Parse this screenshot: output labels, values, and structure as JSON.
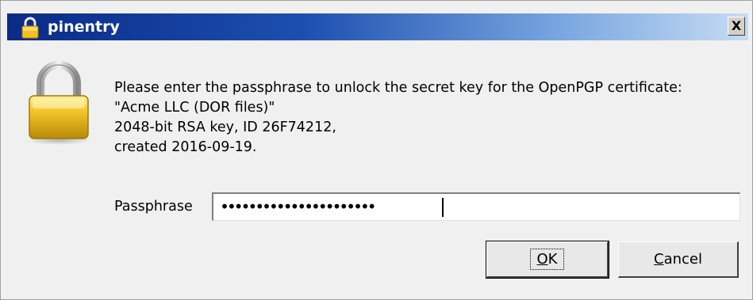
{
  "window": {
    "title": "pinentry",
    "close_label": "X",
    "title_icon": "lock-icon"
  },
  "dialog": {
    "icon": "padlock-icon",
    "message_lines": [
      "Please enter the passphrase to unlock the secret key for the OpenPGP certificate:",
      "\"Acme LLC (DOR files)\"",
      "2048-bit RSA key, ID 26F74212,",
      "created 2016-09-19."
    ],
    "passphrase_label": "Passphrase",
    "passphrase_value": "••••••••••••••••••••••",
    "ok_mnemonic": "O",
    "ok_rest": "K",
    "cancel_mnemonic": "C",
    "cancel_rest": "ancel"
  },
  "colors": {
    "titlebar_start": "#0a2a86",
    "titlebar_end": "#c6dcf3",
    "dialog_bg": "#f0f0f0",
    "lock_gold": "#e8b820"
  }
}
